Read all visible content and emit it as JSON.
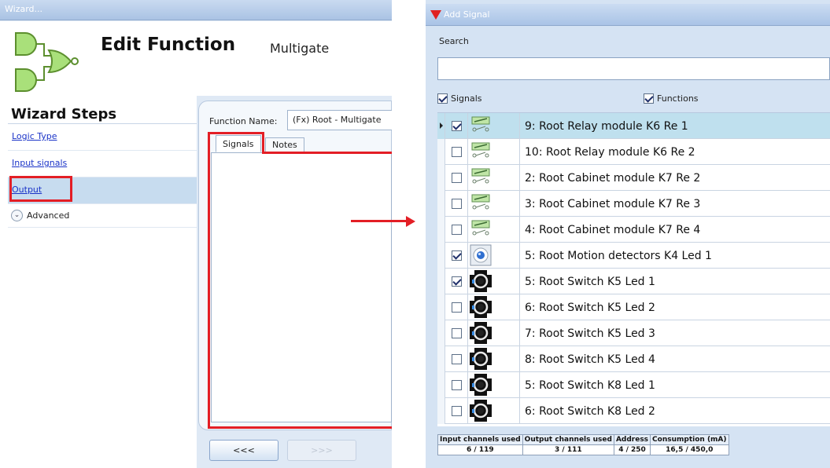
{
  "wizard": {
    "window_title": "Wizard...",
    "title": "Edit Function",
    "subtitle": "Multigate",
    "steps_title": "Wizard Steps",
    "steps": [
      {
        "label": "Logic Type"
      },
      {
        "label": "Input signals"
      },
      {
        "label": "Output"
      }
    ],
    "advanced_label": "Advanced",
    "function_name_label": "Function Name:",
    "function_name_value": "(Fx) Root - Multigate",
    "tabs": [
      {
        "label": "Signals"
      },
      {
        "label": "Notes"
      }
    ],
    "prev_button": "<<<",
    "next_button": ">>>"
  },
  "add_signal": {
    "window_title": "Add Signal",
    "search_label": "Search",
    "search_value": "",
    "filter_signals": {
      "label": "Signals",
      "checked": true
    },
    "filter_functions": {
      "label": "Functions",
      "checked": true
    },
    "rows": [
      {
        "checked": true,
        "icon": "relay-icon",
        "name": "9: Root Relay module K6 Re 1"
      },
      {
        "checked": false,
        "icon": "relay-icon",
        "name": "10: Root Relay module K6 Re 2"
      },
      {
        "checked": false,
        "icon": "relay-icon",
        "name": "2: Root Cabinet module K7 Re 2"
      },
      {
        "checked": false,
        "icon": "relay-icon",
        "name": "3: Root Cabinet module K7 Re 3"
      },
      {
        "checked": false,
        "icon": "relay-icon",
        "name": "4: Root Cabinet module K7 Re 4"
      },
      {
        "checked": true,
        "icon": "motion-detector-icon",
        "name": "5: Root Motion detectors K4 Led 1"
      },
      {
        "checked": true,
        "icon": "switch-led-icon",
        "name": "5: Root Switch K5 Led 1"
      },
      {
        "checked": false,
        "icon": "switch-led-icon",
        "name": "6: Root Switch K5 Led 2"
      },
      {
        "checked": false,
        "icon": "switch-led-icon",
        "name": "7: Root Switch K5 Led 3"
      },
      {
        "checked": false,
        "icon": "switch-led-icon",
        "name": "8: Root Switch K5 Led 4"
      },
      {
        "checked": false,
        "icon": "switch-led-icon",
        "name": "5: Root Switch K8 Led 1"
      },
      {
        "checked": false,
        "icon": "switch-led-icon",
        "name": "6: Root Switch K8 Led 2"
      }
    ],
    "status": {
      "headers": [
        "Input channels used",
        "Output channels used",
        "Address",
        "Consumption (mA)"
      ],
      "values": [
        "6 / 119",
        "3 / 111",
        "4 / 250",
        "16,5 / 450,0"
      ]
    }
  },
  "colors": {
    "highlight": "#e31e25",
    "selected_row": "#bfe0ee",
    "link": "#1a33c8"
  }
}
